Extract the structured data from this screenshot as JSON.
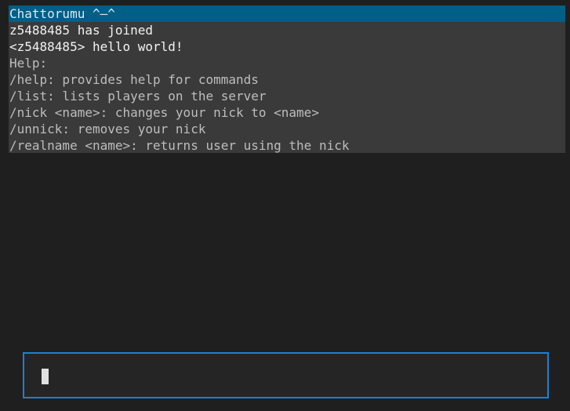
{
  "app": {
    "title": "Chattorumu ^–^"
  },
  "messages": [
    {
      "text": "z5488485 has joined",
      "kind": "user"
    },
    {
      "text": "<z5488485> hello world!",
      "kind": "user"
    },
    {
      "text": "Help:",
      "kind": "system"
    },
    {
      "text": "/help: provides help for commands",
      "kind": "system"
    },
    {
      "text": "/list: lists players on the server",
      "kind": "system"
    },
    {
      "text": "/nick <name>: changes your nick to <name>",
      "kind": "system"
    },
    {
      "text": "/unnick: removes your nick",
      "kind": "system"
    },
    {
      "text": "/realname <name>: returns user using the nick",
      "kind": "system"
    }
  ],
  "input": {
    "value": ""
  },
  "colors": {
    "background": "#1e1e1e",
    "panel": "#3a3a3a",
    "title_bar": "#005f87",
    "input_border": "#1d7fd4",
    "cursor": "#e0e0e0"
  }
}
